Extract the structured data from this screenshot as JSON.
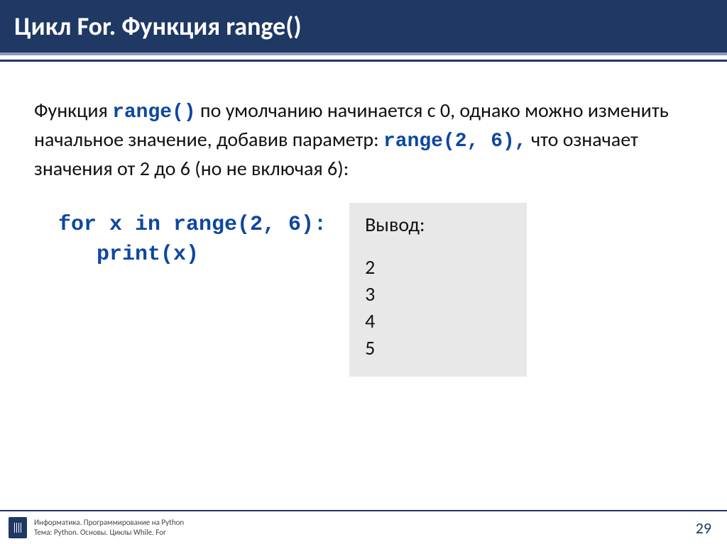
{
  "header": {
    "title": "Цикл For. Функция range()"
  },
  "body": {
    "p1_a": "Функция ",
    "p1_code1": "range()",
    "p1_b": "  по умолчанию начинается с 0, однако можно изменить начальное значение, добавив параметр: ",
    "p1_code2": "range(2, 6),",
    "p1_c": " что означает значения от 2 до 6 (но не включая 6):",
    "code": "for x in range(2, 6):\n   print(x)",
    "output_title": "Вывод:",
    "output_lines": [
      "2",
      "3",
      "4",
      "5"
    ]
  },
  "footer": {
    "line1": "Информатика. Программирование на Python",
    "line2": "Тема: Python. Основы. Циклы While. For",
    "slide_number": "29"
  }
}
